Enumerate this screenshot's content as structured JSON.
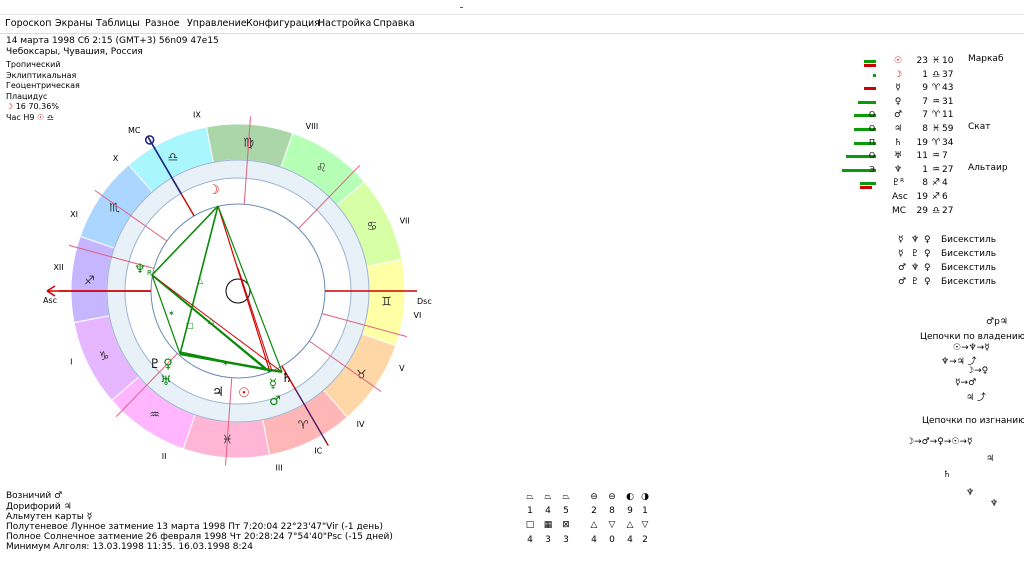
{
  "window": {
    "title": ""
  },
  "menu": [
    "Гороскоп",
    "Экраны",
    "Таблицы",
    "Разное",
    "Управление",
    "Конфигурация",
    "Настройка",
    "Справка"
  ],
  "header": {
    "date_line": "14 марта 1998  Сб   2:15 (GMT+3)  56n09  47e15",
    "place": "Чебоксары, Чувашия, Россия",
    "tropical": "Тропический",
    "ecliptic": "Эклиптикальная",
    "geocentric": "Геоцентрическая",
    "houses": "Плацидус",
    "moon_phase": "16  70.36%",
    "hour_label": "Час H9"
  },
  "chart": {
    "signs": [
      "♈",
      "♉",
      "♊",
      "♋",
      "♌",
      "♍",
      "♎",
      "♏",
      "♐",
      "♑",
      "♒",
      "♓"
    ],
    "sign_colors": [
      "#ffb6b6",
      "#ffd6a6",
      "#ffffa6",
      "#d6ffa6",
      "#b6ffb6",
      "#aad6aa",
      "#aaf6ff",
      "#aad6ff",
      "#c6b6ff",
      "#e6b6ff",
      "#ffb6ff",
      "#ffb6d6"
    ],
    "house_labels": [
      "I",
      "II",
      "III",
      "IV",
      "V",
      "VI",
      "VII",
      "VIII",
      "IX",
      "X",
      "XI",
      "XII"
    ],
    "angle_labels": {
      "asc": "Asc",
      "dsc": "Dsc",
      "mc": "MC",
      "ic": "IC"
    },
    "inner_glyphs": [
      {
        "glyph": "☽",
        "color": "#d00000"
      },
      {
        "glyph": "♆",
        "color": "#008000",
        "sub": "R"
      },
      {
        "glyph": "♇",
        "color": "#000000"
      },
      {
        "glyph": "♀",
        "color": "#008000"
      },
      {
        "glyph": "♅",
        "color": "#008000"
      },
      {
        "glyph": "♃",
        "color": "#000000"
      },
      {
        "glyph": "☉",
        "color": "#d00000"
      },
      {
        "glyph": "☿",
        "color": "#008000"
      },
      {
        "glyph": "♂",
        "color": "#008000"
      },
      {
        "glyph": "♄",
        "color": "#000000"
      }
    ]
  },
  "planets": [
    {
      "mark": "",
      "glyph": "☉",
      "deg": "23",
      "sign": "♓",
      "min": "10",
      "star": "Маркаб",
      "glyph_color": "#d00000"
    },
    {
      "mark": "",
      "glyph": "☽",
      "deg": "1",
      "sign": "♎",
      "min": "37",
      "star": "",
      "glyph_color": "#d00000"
    },
    {
      "mark": "",
      "glyph": "☿",
      "deg": "9",
      "sign": "♈",
      "min": "43",
      "star": "",
      "glyph_color": "#000000"
    },
    {
      "mark": "",
      "glyph": "♀",
      "deg": "7",
      "sign": "♒",
      "min": "31",
      "star": "",
      "glyph_color": "#000000"
    },
    {
      "mark": "О",
      "glyph": "♂",
      "deg": "7",
      "sign": "♈",
      "min": "11",
      "star": "",
      "glyph_color": "#000000"
    },
    {
      "mark": "О",
      "glyph": "♃",
      "deg": "8",
      "sign": "♓",
      "min": "59",
      "star": "Скат",
      "glyph_color": "#000000"
    },
    {
      "mark": "П",
      "glyph": "♄",
      "deg": "19",
      "sign": "♈",
      "min": "34",
      "star": "",
      "glyph_color": "#000000"
    },
    {
      "mark": "О",
      "glyph": "♅",
      "deg": "11",
      "sign": "♒",
      "min": "7",
      "star": "",
      "glyph_color": "#000000"
    },
    {
      "mark": "Э",
      "glyph": "♆",
      "deg": "1",
      "sign": "♒",
      "min": "27",
      "star": "Альтаир",
      "glyph_color": "#000000"
    },
    {
      "mark": "",
      "glyph": "♇ᴿ",
      "deg": "8",
      "sign": "♐",
      "min": "4",
      "star": "",
      "glyph_color": "#000000"
    },
    {
      "mark": "",
      "glyph": "Asc",
      "deg": "19",
      "sign": "♐",
      "min": "6",
      "star": "",
      "glyph_color": "#000000"
    },
    {
      "mark": "",
      "glyph": "MC",
      "deg": "29",
      "sign": "♎",
      "min": "27",
      "star": "",
      "glyph_color": "#000000"
    }
  ],
  "aspects": [
    {
      "p1": "☿",
      "p2": "♆",
      "p3": "♀",
      "name": "Бисекстиль"
    },
    {
      "p1": "☿",
      "p2": "♇",
      "p3": "♀",
      "name": "Бисекстиль"
    },
    {
      "p1": "♂",
      "p2": "♆",
      "p3": "♀",
      "name": "Бисекстиль"
    },
    {
      "p1": "♂",
      "p2": "♇",
      "p3": "♀",
      "name": "Бисекстиль"
    }
  ],
  "reception": "♂р♃",
  "chains": {
    "rulership_title": "Цепочки по владению",
    "rulership_lines": [
      "☉→♆→☿",
      "♆→♃ ⤴",
      "☽→♀",
      "☿→♂",
      "♃ ⤴"
    ],
    "exile_title": "Цепочки по изгнанию",
    "exile_lines": [
      "☽→♂→♀→☉→☿",
      "♃",
      "♄",
      "♆",
      "♆"
    ]
  },
  "bottom": {
    "lines": [
      "Возничий  ♂",
      "Дорифорий  ♃",
      "Альмутен карты  ☿",
      "Полутеневое Лунное затмение 13 марта 1998 Пт  7:20:04 22°23'47\"Vir (-1 день)",
      "Полное Солнечное затмение 26 февраля 1998 Чт 20:28:24  7°54'40\"Psc (-15 дней)",
      "Минимум Алголя: 13.03.1998 11:35.  16.03.1998  8:24"
    ]
  },
  "stats": {
    "row1_symbols": [
      "⏢",
      "⏢",
      "⏢",
      "⊖",
      "⊖",
      "◐",
      "◑"
    ],
    "row1_values": [
      "1",
      "4",
      "5",
      "2",
      "8",
      "9",
      "1"
    ],
    "row2_symbols": [
      "□",
      "▦",
      "⊠",
      "△",
      "▽",
      "△",
      "▽"
    ],
    "row2_values": [
      "4",
      "3",
      "3",
      "4",
      "0",
      "4",
      "2"
    ]
  }
}
